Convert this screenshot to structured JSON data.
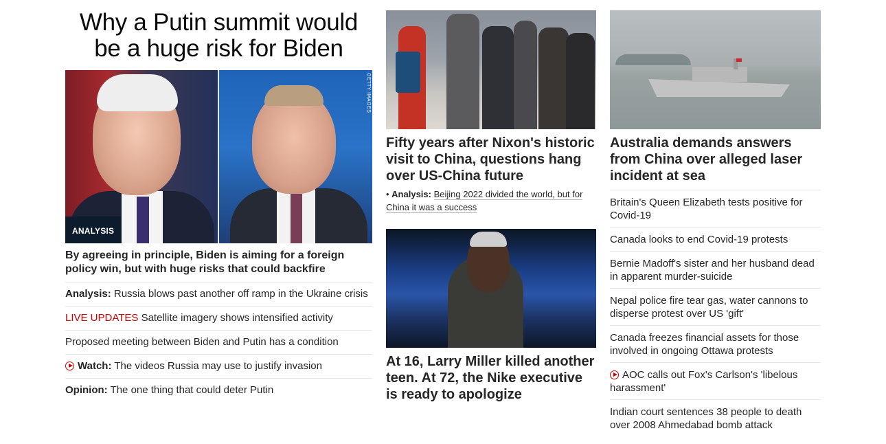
{
  "main_story": {
    "headline": "Why a Putin summit would be a huge risk for Biden",
    "image_credit": "GETTY IMAGES",
    "badge": "ANALYSIS",
    "lead": "By agreeing in principle, Biden is aiming for a foreign policy win, but with huge risks that could backfire",
    "related": [
      {
        "prefix": "Analysis:",
        "text": " Russia blows past another off ramp in the Ukraine crisis"
      },
      {
        "prefix": "LIVE UPDATES",
        "text": " Satellite imagery shows intensified activity"
      },
      {
        "prefix": "",
        "text": "Proposed meeting between Biden and Putin has a condition"
      },
      {
        "prefix": "Watch:",
        "text": " The videos Russia may use to justify invasion",
        "icon": "play-icon"
      },
      {
        "prefix": "Opinion:",
        "text": " The one thing that could deter Putin"
      }
    ]
  },
  "middle": {
    "story1": {
      "headline": "Fifty years after Nixon's historic visit to China, questions hang over US-China future",
      "sub_prefix": "Analysis:",
      "sub_text": "Beijing 2022 divided the world, but for China it was a success"
    },
    "story2": {
      "headline": "At 16, Larry Miller killed another teen. At 72, the Nike executive is ready to apologize"
    }
  },
  "right": {
    "headline": "Australia demands answers from China over alleged laser incident at sea",
    "items": [
      {
        "text": "Britain's Queen Elizabeth tests positive for Covid-19"
      },
      {
        "text": "Canada looks to end Covid-19 protests"
      },
      {
        "text": "Bernie Madoff's sister and her husband dead in apparent murder-suicide"
      },
      {
        "text": "Nepal police fire tear gas, water cannons to disperse protest over US 'gift'"
      },
      {
        "text": "Canada freezes financial assets for those involved in ongoing Ottawa protests"
      },
      {
        "text": "AOC calls out Fox's Carlson's 'libelous harassment'",
        "icon": "play-icon"
      },
      {
        "text": "Indian court sentences 38 people to death over 2008 Ahmedabad bomb attack"
      }
    ]
  },
  "colors": {
    "live": "#cc0000",
    "badge_bg": "#0c1c2c",
    "text": "#262626"
  }
}
